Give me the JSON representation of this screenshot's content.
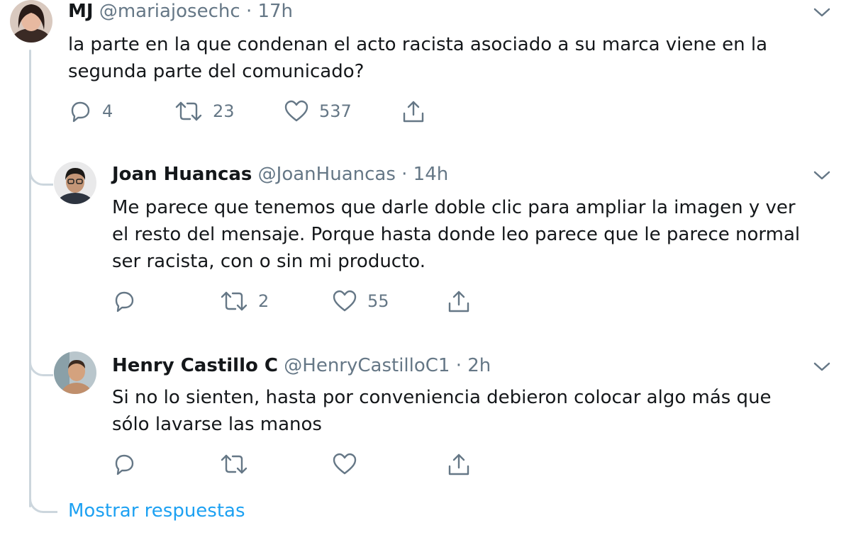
{
  "colors": {
    "text": "#14171a",
    "secondary": "#657786",
    "link": "#1da1f2",
    "thread_line": "#ccd6dd"
  },
  "tweets": [
    {
      "name": "MJ",
      "handle": "@mariajosechc",
      "separator": "·",
      "time": "17h",
      "text": "la parte en la que condenan el acto racista asociado a su marca viene en la\nsegunda parte del comunicado?",
      "replies": "4",
      "retweets": "23",
      "likes": "537",
      "icons": [
        "reply-icon",
        "retweet-icon",
        "like-icon",
        "share-icon",
        "chevron-down-icon"
      ]
    },
    {
      "name": "Joan Huancas",
      "handle": "@JoanHuancas",
      "separator": "·",
      "time": "14h",
      "text": "Me parece que tenemos que darle doble clic para ampliar la imagen y ver\nel resto del mensaje. Porque hasta donde leo parece que le parece normal\nser racista, con o sin mi producto.",
      "replies": "",
      "retweets": "2",
      "likes": "55",
      "icons": [
        "reply-icon",
        "retweet-icon",
        "like-icon",
        "share-icon",
        "chevron-down-icon"
      ]
    },
    {
      "name": "Henry Castillo C",
      "handle": "@HenryCastilloC1",
      "separator": "·",
      "time": "2h",
      "text": "Si no lo sienten, hasta por conveniencia debieron colocar algo más que\nsólo lavarse las manos",
      "replies": "",
      "retweets": "",
      "likes": "",
      "icons": [
        "reply-icon",
        "retweet-icon",
        "like-icon",
        "share-icon",
        "chevron-down-icon"
      ]
    }
  ],
  "show_replies_label": "Mostrar respuestas"
}
